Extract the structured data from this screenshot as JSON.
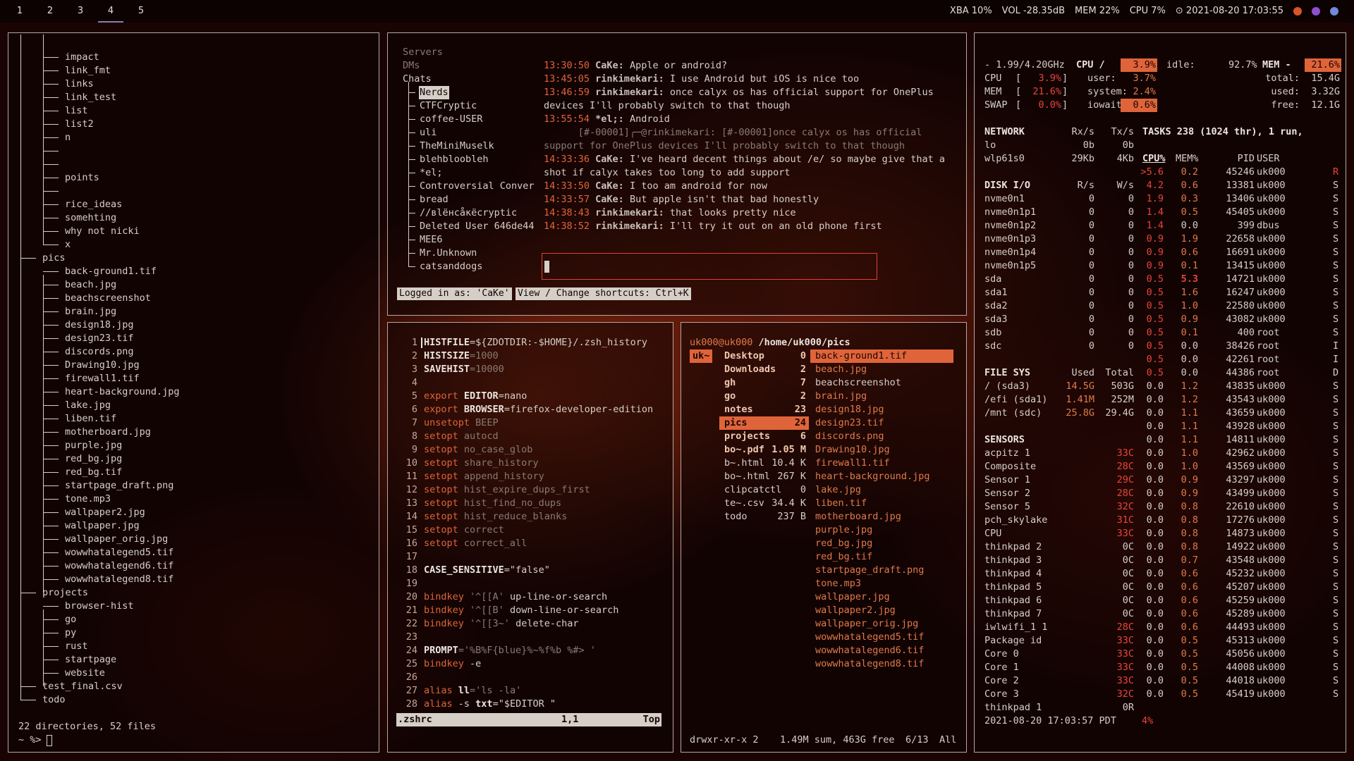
{
  "topbar": {
    "workspaces": [
      "1",
      "2",
      "3",
      "4",
      "5"
    ],
    "active_workspace": "4",
    "status": [
      "XBA 10%",
      "VOL -28.35dB",
      "MEM 22%",
      "CPU 7%",
      "⊙ 2021-08-20 17:03:55"
    ],
    "tray_icons": [
      "orange-swirl-icon",
      "firefox-icon",
      "discord-icon"
    ]
  },
  "tree": {
    "top_items": [
      "impact",
      "link_fmt",
      "links",
      "link_test",
      "list",
      "list2",
      "n",
      "",
      "",
      "points",
      "",
      "rice_ideas",
      "somehting",
      "why not nicki",
      "x"
    ],
    "pics_dir": "pics",
    "pics": [
      "back-ground1.tif",
      "beach.jpg",
      "beachscreenshot",
      "brain.jpg",
      "design18.jpg",
      "design23.tif",
      "discords.png",
      "Drawing10.jpg",
      "firewall1.tif",
      "heart-background.jpg",
      "lake.jpg",
      "liben.tif",
      "motherboard.jpg",
      "purple.jpg",
      "red_bg.jpg",
      "red_bg.tif",
      "startpage_draft.png",
      "tone.mp3",
      "wallpaper2.jpg",
      "wallpaper.jpg",
      "wallpaper_orig.jpg",
      "wowwhatalegend5.tif",
      "wowwhatalegend6.tif",
      "wowwhatalegend8.tif"
    ],
    "projects_dir": "projects",
    "projects": [
      "browser-hist",
      "go",
      "py",
      "rust",
      "startpage",
      "website"
    ],
    "root_files": [
      "test_final.csv",
      "todo"
    ],
    "summary": "22 directories, 52 files",
    "prompt": "~ %>"
  },
  "chat": {
    "sections": [
      "Servers",
      "DMs",
      "Chats"
    ],
    "chats": [
      "Nerds",
      "CTFCryptic",
      "coffee-USER",
      "uli",
      "TheMiniMuselk",
      "blehbloobleh",
      "*el;",
      "Controversial Conver",
      "bread",
      "//вlёнсåкёcryptic",
      "Deleted User 646de44",
      "MEE6",
      "Mr.Unknown",
      "catsanddogs"
    ],
    "selected_chat": "Nerds",
    "messages": [
      {
        "t": "13:30:50",
        "n": "CaKe:",
        "m": "Apple or android?"
      },
      {
        "t": "13:45:05",
        "n": "rinkimekari:",
        "m": "I use Android but iOS is nice too"
      },
      {
        "t": "13:46:59",
        "n": "rinkimekari:",
        "m": "once calyx os has official support for OnePlus"
      },
      {
        "t": "",
        "n": "",
        "m": "devices I'll probably switch to that though"
      },
      {
        "t": "13:55:54",
        "n": "*el;:",
        "m": "Android"
      },
      {
        "t": "",
        "n": "",
        "m": "      [#-00001]╭─@rinkimekari: [#-00001]once calyx os has official"
      },
      {
        "t": "",
        "n": "",
        "m": "support for OnePlus devices I'll probably switch to that though"
      },
      {
        "t": "14:33:36",
        "n": "CaKe:",
        "m": "I've heard decent things about /e/ so maybe give that a"
      },
      {
        "t": "",
        "n": "",
        "m": "shot if calyx takes too long to add support"
      },
      {
        "t": "14:33:50",
        "n": "CaKe:",
        "m": "I too am android for now"
      },
      {
        "t": "14:33:57",
        "n": "CaKe:",
        "m": "But apple isn't that bad honestly"
      },
      {
        "t": "14:38:43",
        "n": "rinkimekari:",
        "m": "that looks pretty nice"
      },
      {
        "t": "14:38:52",
        "n": "rinkimekari:",
        "m": "I'll try it out on an old phone first"
      }
    ],
    "logged_in": "Logged in as: 'CaKe'",
    "shortcuts": "View / Change shortcuts: Ctrl+K"
  },
  "vim": {
    "lines": [
      [
        [
          "bold",
          "HISTFILE"
        ],
        [
          "strc",
          "=${ZDOTDIR:-$HOME}/.zsh_history"
        ]
      ],
      [
        [
          "bold",
          "HISTSIZE"
        ],
        [
          "dim",
          "=1000"
        ]
      ],
      [
        [
          "bold",
          "SAVEHIST"
        ],
        [
          "dim",
          "=10000"
        ]
      ],
      [],
      [
        [
          "kw",
          "export "
        ],
        [
          "bold",
          "EDITOR"
        ],
        [
          "strc",
          "=nano"
        ]
      ],
      [
        [
          "kw",
          "export "
        ],
        [
          "bold",
          "BROWSER"
        ],
        [
          "strc",
          "=firefox-developer-edition"
        ]
      ],
      [
        [
          "kw",
          "unsetopt "
        ],
        [
          "dim",
          "BEEP"
        ]
      ],
      [
        [
          "kw",
          "setopt "
        ],
        [
          "dim",
          "autocd"
        ]
      ],
      [
        [
          "kw",
          "setopt "
        ],
        [
          "dim",
          "no_case_glob"
        ]
      ],
      [
        [
          "kw",
          "setopt "
        ],
        [
          "dim",
          "share_history"
        ]
      ],
      [
        [
          "kw",
          "setopt "
        ],
        [
          "dim",
          "append_history"
        ]
      ],
      [
        [
          "kw",
          "setopt "
        ],
        [
          "dim",
          "hist_expire_dups_first"
        ]
      ],
      [
        [
          "kw",
          "setopt "
        ],
        [
          "dim",
          "hist_find_no_dups"
        ]
      ],
      [
        [
          "kw",
          "setopt "
        ],
        [
          "dim",
          "hist_reduce_blanks"
        ]
      ],
      [
        [
          "kw",
          "setopt "
        ],
        [
          "dim",
          "correct"
        ]
      ],
      [
        [
          "kw",
          "setopt "
        ],
        [
          "dim",
          "correct_all"
        ]
      ],
      [],
      [
        [
          "bold",
          "CASE_SENSITIVE"
        ],
        [
          "strc",
          "=\"false\""
        ]
      ],
      [],
      [
        [
          "kw",
          "bindkey "
        ],
        [
          "dim",
          "'^[[A' "
        ],
        [
          "strc",
          "up-line-or-search"
        ]
      ],
      [
        [
          "kw",
          "bindkey "
        ],
        [
          "dim",
          "'^[[B' "
        ],
        [
          "strc",
          "down-line-or-search"
        ]
      ],
      [
        [
          "kw",
          "bindkey "
        ],
        [
          "dim",
          "'^[[3~' "
        ],
        [
          "strc",
          "delete-char"
        ]
      ],
      [],
      [
        [
          "bold",
          "PROMPT"
        ],
        [
          "dim",
          "='%B%F{blue}%~%f%b %#> '"
        ]
      ],
      [
        [
          "kw",
          "bindkey "
        ],
        [
          "strc",
          "-e"
        ]
      ],
      [],
      [
        [
          "kw",
          "alias "
        ],
        [
          "bold",
          "ll"
        ],
        [
          "dim",
          "='ls -la'"
        ]
      ],
      [
        [
          "kw",
          "alias "
        ],
        [
          "strc",
          "-s "
        ],
        [
          "bold",
          "txt"
        ],
        [
          "strc",
          "=\"$EDITOR \""
        ]
      ]
    ],
    "status_file": ".zshrc",
    "status_pos": "1,1",
    "status_scroll": "Top"
  },
  "ranger": {
    "path_user": "uk000@uk000",
    "path_dir": "/home/uk000/",
    "path_cur": "pics",
    "parent": "uk~",
    "middle": [
      {
        "n": "Desktop",
        "s": "0",
        "d": true
      },
      {
        "n": "Downloads",
        "s": "2",
        "d": true
      },
      {
        "n": "gh",
        "s": "7",
        "d": true
      },
      {
        "n": "go",
        "s": "2",
        "d": true
      },
      {
        "n": "notes",
        "s": "23",
        "d": true
      },
      {
        "n": "pics",
        "s": "24",
        "d": true,
        "sel": true
      },
      {
        "n": "projects",
        "s": "6",
        "d": true
      },
      {
        "n": "bo~.pdf",
        "s": "1.05 M",
        "d": true
      },
      {
        "n": "b~.html",
        "s": "10.4 K"
      },
      {
        "n": "bo~.html",
        "s": "267 K"
      },
      {
        "n": "clipcatctl",
        "s": "0"
      },
      {
        "n": "te~.csv",
        "s": "34.4 K"
      },
      {
        "n": "todo",
        "s": "237 B"
      }
    ],
    "right": [
      "back-ground1.tif",
      "beach.jpg",
      "beachscreenshot",
      "brain.jpg",
      "design18.jpg",
      "design23.tif",
      "discords.png",
      "Drawing10.jpg",
      "firewall1.tif",
      "heart-background.jpg",
      "lake.jpg",
      "liben.tif",
      "motherboard.jpg",
      "purple.jpg",
      "red_bg.jpg",
      "red_bg.tif",
      "startpage_draft.png",
      "tone.mp3",
      "wallpaper.jpg",
      "wallpaper2.jpg",
      "wallpaper_orig.jpg",
      "wowwhatalegend5.tif",
      "wowwhatalegend6.tif",
      "wowwhatalegend8.tif"
    ],
    "status_perm": "drwxr-xr-x 2",
    "status_info": "1.49M sum, 463G free",
    "status_pos": "6/13",
    "status_all": "All"
  },
  "monitor": {
    "cpu_freq": "- 1.99/4.20GHz",
    "cpu_label": "CPU /",
    "cpu_pct": "3.9%",
    "idle_label": "idle:",
    "idle": "92.7%",
    "mem_label": "MEM -",
    "mem_pct": "21.6%",
    "meters": [
      {
        "l": "CPU",
        "v": "3.9%",
        "k": "user:",
        "kv": "3.7%",
        "t": "total:",
        "tv": "15.4G"
      },
      {
        "l": "MEM",
        "v": "21.6%",
        "k": "system:",
        "kv": "2.4%",
        "t": "used:",
        "tv": "3.32G"
      },
      {
        "l": "SWAP",
        "v": "0.0%",
        "k": "iowait:",
        "kv": "0.6%",
        "t": "free:",
        "tv": "12.1G"
      }
    ],
    "network_hdr": [
      "NETWORK",
      "Rx/s",
      "Tx/s"
    ],
    "network": [
      [
        "lo",
        "0b",
        "0b"
      ],
      [
        "wlp61s0",
        "29Kb",
        "4Kb"
      ]
    ],
    "disk_hdr": [
      "DISK I/O",
      "R/s",
      "W/s"
    ],
    "disks": [
      [
        "nvme0n1",
        "0",
        "0"
      ],
      [
        "nvme0n1p1",
        "0",
        "0"
      ],
      [
        "nvme0n1p2",
        "0",
        "0"
      ],
      [
        "nvme0n1p3",
        "0",
        "0"
      ],
      [
        "nvme0n1p4",
        "0",
        "0"
      ],
      [
        "nvme0n1p5",
        "0",
        "0"
      ],
      [
        "sda",
        "0",
        "0"
      ],
      [
        "sda1",
        "0",
        "0"
      ],
      [
        "sda2",
        "0",
        "0"
      ],
      [
        "sda3",
        "0",
        "0"
      ],
      [
        "sdb",
        "0",
        "0"
      ],
      [
        "sdc",
        "0",
        "0"
      ]
    ],
    "fs_hdr": [
      "FILE SYS",
      "Used",
      "Total"
    ],
    "fs": [
      [
        "/ (sda3)",
        "14.5G",
        "503G"
      ],
      [
        "/efi (sda1)",
        "1.41M",
        "252M"
      ],
      [
        "/mnt (sdc)",
        "25.8G",
        "29.4G"
      ]
    ],
    "sensors_hdr": "SENSORS",
    "sensors": [
      [
        "acpitz 1",
        "33C"
      ],
      [
        "Composite",
        "28C"
      ],
      [
        "Sensor 1",
        "29C"
      ],
      [
        "Sensor 2",
        "28C"
      ],
      [
        "Sensor 5",
        "32C"
      ],
      [
        "pch_skylake",
        "31C"
      ],
      [
        "CPU",
        "33C"
      ],
      [
        "thinkpad 2",
        "0C"
      ],
      [
        "thinkpad 3",
        "0C"
      ],
      [
        "thinkpad 4",
        "0C"
      ],
      [
        "thinkpad 5",
        "0C"
      ],
      [
        "thinkpad 6",
        "0C"
      ],
      [
        "thinkpad 7",
        "0C"
      ],
      [
        "iwlwifi_1 1",
        "28C"
      ],
      [
        "Package id",
        "33C"
      ],
      [
        "Core 0",
        "33C"
      ],
      [
        "Core 1",
        "33C"
      ],
      [
        "Core 2",
        "33C"
      ],
      [
        "Core 3",
        "32C"
      ],
      [
        "thinkpad 1",
        "0R"
      ]
    ],
    "tasks": "TASKS 238 (1024 thr), 1 run,",
    "proc_hdr": [
      "CPU%",
      "MEM%",
      "PID",
      "USER",
      ""
    ],
    "procs": [
      [
        "",
        ">5.6",
        "0.2",
        "45246",
        "uk000",
        "R"
      ],
      [
        "",
        "4.2",
        "0.6",
        "13381",
        "uk000",
        "S"
      ],
      [
        "",
        "1.9",
        "0.3",
        "13406",
        "uk000",
        "S"
      ],
      [
        "",
        "1.4",
        "0.5",
        "45405",
        "uk000",
        "S"
      ],
      [
        "",
        "1.4",
        "0.0",
        "399",
        "dbus",
        "S"
      ],
      [
        "",
        "0.9",
        "1.9",
        "22658",
        "uk000",
        "S"
      ],
      [
        "",
        "0.9",
        "0.6",
        "16691",
        "uk000",
        "S"
      ],
      [
        "",
        "0.9",
        "0.1",
        "13415",
        "uk000",
        "S"
      ],
      [
        "",
        "0.5",
        "5.3",
        "14721",
        "uk000",
        "S"
      ],
      [
        "",
        "0.5",
        "1.6",
        "16247",
        "uk000",
        "S"
      ],
      [
        "",
        "0.5",
        "1.0",
        "22580",
        "uk000",
        "S"
      ],
      [
        "",
        "0.5",
        "0.9",
        "43082",
        "uk000",
        "S"
      ],
      [
        "",
        "0.5",
        "0.1",
        "400",
        "root",
        "S"
      ],
      [
        "",
        "0.5",
        "0.0",
        "38426",
        "root",
        "I"
      ],
      [
        "",
        "0.5",
        "0.0",
        "42261",
        "root",
        "I"
      ],
      [
        "",
        "0.5",
        "0.0",
        "44386",
        "root",
        "D"
      ],
      [
        "",
        "0.0",
        "1.2",
        "43835",
        "uk000",
        "S"
      ],
      [
        "",
        "0.0",
        "1.2",
        "43543",
        "uk000",
        "S"
      ],
      [
        "",
        "0.0",
        "1.1",
        "43659",
        "uk000",
        "S"
      ],
      [
        "",
        "0.0",
        "1.1",
        "43928",
        "uk000",
        "S"
      ],
      [
        "",
        "0.0",
        "1.1",
        "14811",
        "uk000",
        "S"
      ],
      [
        "",
        "0.0",
        "1.0",
        "42962",
        "uk000",
        "S"
      ],
      [
        "",
        "0.0",
        "1.0",
        "43569",
        "uk000",
        "S"
      ],
      [
        "",
        "0.0",
        "0.9",
        "43297",
        "uk000",
        "S"
      ],
      [
        "",
        "0.0",
        "0.9",
        "43499",
        "uk000",
        "S"
      ],
      [
        "",
        "0.0",
        "0.8",
        "22610",
        "uk000",
        "S"
      ],
      [
        "",
        "0.0",
        "0.8",
        "17276",
        "uk000",
        "S"
      ],
      [
        "",
        "0.0",
        "0.8",
        "14873",
        "uk000",
        "S"
      ],
      [
        "",
        "0.0",
        "0.8",
        "14922",
        "uk000",
        "S"
      ],
      [
        "",
        "0.0",
        "0.7",
        "43548",
        "uk000",
        "S"
      ],
      [
        "",
        "0.0",
        "0.6",
        "45232",
        "uk000",
        "S"
      ],
      [
        "",
        "0.0",
        "0.6",
        "45207",
        "uk000",
        "S"
      ],
      [
        "",
        "0.0",
        "0.6",
        "45259",
        "uk000",
        "S"
      ],
      [
        "",
        "0.0",
        "0.6",
        "45289",
        "uk000",
        "S"
      ],
      [
        "",
        "0.0",
        "0.6",
        "44493",
        "uk000",
        "S"
      ],
      [
        "",
        "0.0",
        "0.5",
        "45313",
        "uk000",
        "S"
      ],
      [
        "",
        "0.0",
        "0.5",
        "45056",
        "uk000",
        "S"
      ],
      [
        "",
        "0.0",
        "0.5",
        "44008",
        "uk000",
        "S"
      ],
      [
        "",
        "0.0",
        "0.5",
        "44018",
        "uk000",
        "S"
      ],
      [
        "",
        "0.0",
        "0.5",
        "45419",
        "uk000",
        "S"
      ]
    ],
    "clock": "2021-08-20 17:03:57 PDT",
    "clock_pct": "4%"
  }
}
